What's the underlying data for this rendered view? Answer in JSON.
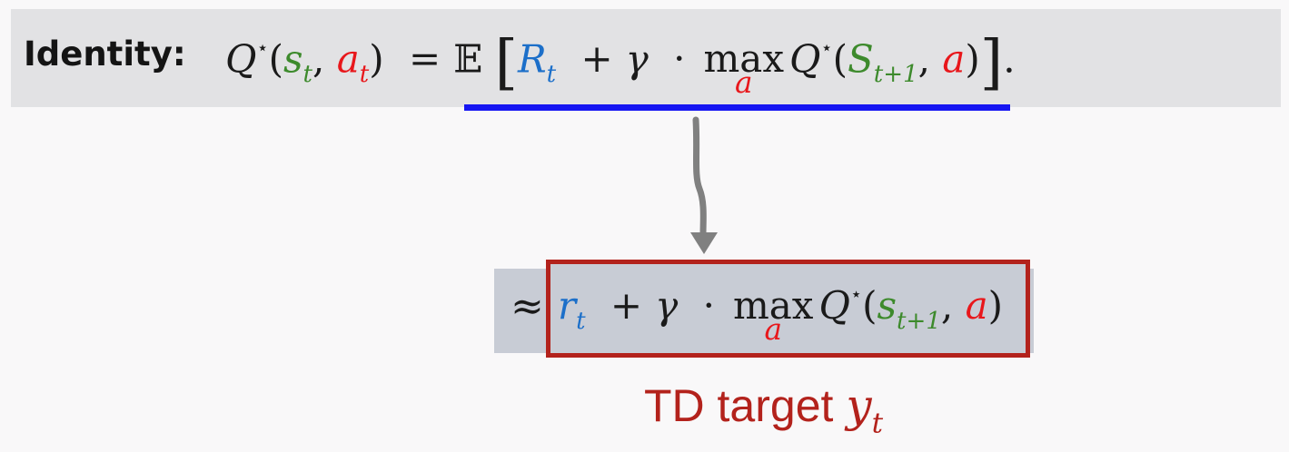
{
  "colors": {
    "green": "#3d8a2c",
    "red": "#e8171b",
    "blue": "#1c6fc9",
    "dark_red": "#b3221c",
    "banner_bg": "#e2e2e4",
    "underline": "#1515f2",
    "arrow": "#808080"
  },
  "identity": {
    "label": "Identity:",
    "Q": "Q",
    "star": "⋆",
    "lparen": "(",
    "s": "s",
    "t": "t",
    "comma": ",",
    "a": "a",
    "rparen": ")",
    "equals": "=",
    "E": "𝔼",
    "lbracket": "[",
    "R": "R",
    "plus": "+",
    "gamma": "γ",
    "cdot": "·",
    "max": "max",
    "max_sub": "a",
    "S": "S",
    "t_plus_1": "t+1",
    "rbracket": "]",
    "period": "."
  },
  "approx": {
    "symbol": "≈",
    "r": "r",
    "t": "t",
    "plus": "+",
    "gamma": "γ",
    "cdot": "·",
    "max": "max",
    "max_sub": "a",
    "Q": "Q",
    "star": "⋆",
    "lparen": "(",
    "s": "s",
    "t_plus_1": "t+1",
    "comma": ",",
    "a": "a",
    "rparen": ")"
  },
  "td_target": {
    "text": "TD target",
    "y": "y",
    "t": "t"
  }
}
